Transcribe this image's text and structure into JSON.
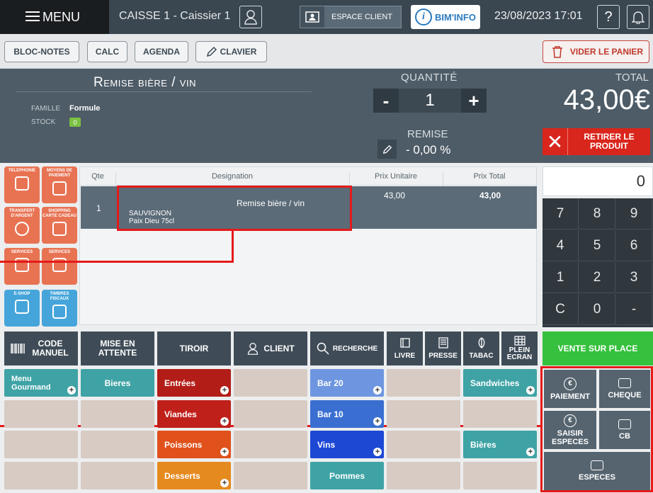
{
  "topbar": {
    "menu_label": "MENU",
    "cashier": "CAISSE 1 - Caissier 1",
    "espace_client": "ESPACE CLIENT",
    "bim_info": "BIM'INFO",
    "datetime": "23/08/2023 17:01",
    "help": "?"
  },
  "toolbar": {
    "bloc_notes": "BLOC-NOTES",
    "calc": "CALC",
    "agenda": "AGENDA",
    "clavier": "CLAVIER",
    "vider": "VIDER LE PANIER"
  },
  "product": {
    "title": "Remise bière / vin",
    "famille_label": "FAMILLE",
    "famille_value": "Formule",
    "stock_label": "STOCK",
    "stock_value": "0",
    "quantite_label": "QUANTITÉ",
    "quantite_value": "1",
    "minus": "-",
    "plus": "+",
    "remise_label": "REMISE",
    "remise_value": "- 0,00 %"
  },
  "total": {
    "label": "TOTAL",
    "value": "43,00€",
    "retirer": "RETIRER LE PRODUIT"
  },
  "services": [
    {
      "label": "TELEPHONIE",
      "color": "#e87353"
    },
    {
      "label": "MOYENS DE PAIEMENT",
      "color": "#e87353"
    },
    {
      "label": "TRANSFERT D'ARGENT",
      "color": "#e87353"
    },
    {
      "label": "SHOPPING CARTE CADEAU",
      "color": "#e87353"
    },
    {
      "label": "SERVICES",
      "color": "#e87353"
    },
    {
      "label": "SERVICES",
      "color": "#e87353"
    },
    {
      "label": "E-SHOP",
      "color": "#45a5da"
    },
    {
      "label": "TIMBRES FISCAUX",
      "color": "#45a5da"
    }
  ],
  "ticket": {
    "columns": [
      "Qte",
      "Designation",
      "Prix Unitaire",
      "Prix Total"
    ],
    "row": {
      "qte": "1",
      "designation": "Remise bière / vin",
      "sub1": "SAUVIGNON",
      "sub2": "Paix Dieu 75cl",
      "prix_unitaire": "43,00",
      "prix_total": "43,00"
    }
  },
  "keypad": {
    "display": "0",
    "keys": [
      "7",
      "8",
      "9",
      "4",
      "5",
      "6",
      "1",
      "2",
      "3",
      "C",
      "0",
      "-"
    ]
  },
  "actions": {
    "code_manuel": "CODE MANUEL",
    "mise_en_attente": "MISE EN ATTENTE",
    "tiroir": "TIROIR",
    "client": "CLIENT",
    "recherche": "RECHERCHE",
    "livre": "LIVRE",
    "presse": "PRESSE",
    "tabac": "TABAC",
    "plein_ecran": "PLEIN ECRAN",
    "vente_sur_place": "VENTE SUR PLACE"
  },
  "categories": {
    "menu_gourmand": "Menu Gourmand",
    "bieres": "Bieres",
    "entrees": "Entrées",
    "viandes": "Viandes",
    "poissons": "Poissons",
    "desserts": "Desserts",
    "bar20": "Bar 20",
    "bar10": "Bar 10",
    "vins": "Vins",
    "pommes": "Pommes",
    "sandwiches": "Sandwiches",
    "bieres2": "Bières"
  },
  "payments": {
    "paiement": "PAIEMENT",
    "cheque": "CHEQUE",
    "saisir_especes": "SAISIR ESPECES",
    "cb": "CB",
    "especes": "ESPECES"
  },
  "colors": {
    "teal": "#3fa3a5",
    "red": "#b31d17",
    "orange": "#e58a1e",
    "blue": "#3a6fd1",
    "green": "#35c13d",
    "highlight": "#e51a1a"
  }
}
